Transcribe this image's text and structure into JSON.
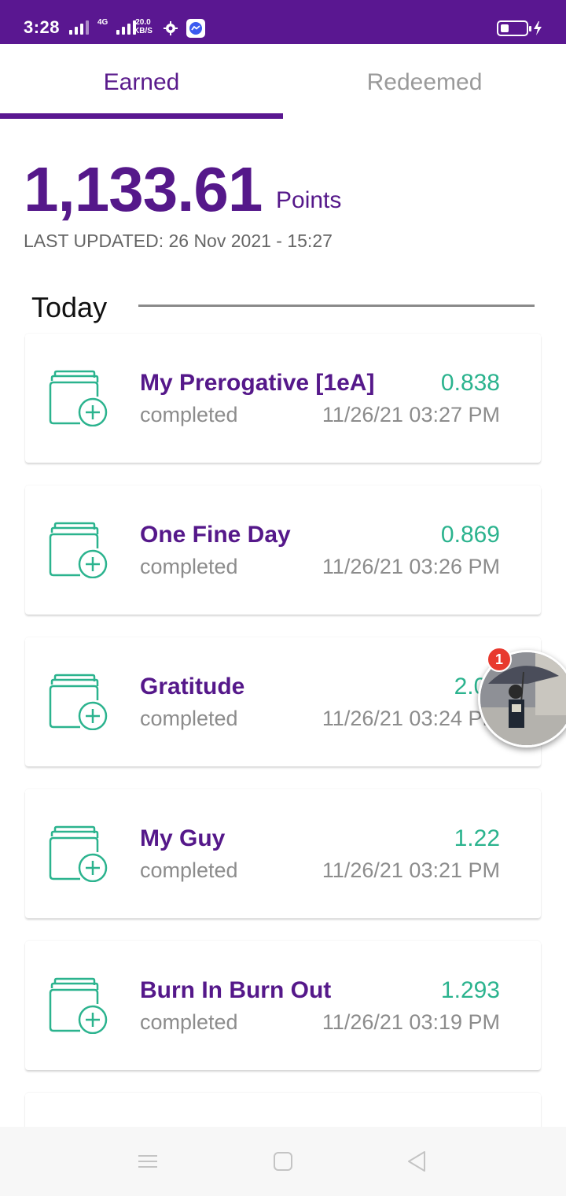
{
  "status_bar": {
    "time": "3:28",
    "network_label": "4G",
    "speed_value": "20.0",
    "speed_unit": "KB/S",
    "icons": [
      "signal-icon",
      "signal-icon",
      "gear-icon",
      "messenger-icon",
      "battery-icon",
      "charging-icon"
    ]
  },
  "tabs": [
    {
      "label": "Earned",
      "active": true
    },
    {
      "label": "Redeemed",
      "active": false
    }
  ],
  "summary": {
    "points": "1,133.61",
    "points_unit": "Points",
    "last_updated": "LAST UPDATED: 26 Nov 2021 - 15:27"
  },
  "section": {
    "title": "Today"
  },
  "transactions": [
    {
      "title": "My Prerogative [1eA]",
      "points": "0.838",
      "status": "completed",
      "time": "11/26/21 03:27 PM"
    },
    {
      "title": "One Fine Day",
      "points": "0.869",
      "status": "completed",
      "time": "11/26/21 03:26 PM"
    },
    {
      "title": "Gratitude",
      "points": "2.09",
      "status": "completed",
      "time": "11/26/21 03:24 PM"
    },
    {
      "title": "My Guy",
      "points": "1.22",
      "status": "completed",
      "time": "11/26/21 03:21 PM"
    },
    {
      "title": "Burn In Burn Out",
      "points": "1.293",
      "status": "completed",
      "time": "11/26/21 03:19 PM"
    }
  ],
  "bubble": {
    "badge": "1"
  },
  "colors": {
    "brand": "#5a1791",
    "points_green": "#2bb38e",
    "muted_text": "#8c8c8c"
  }
}
